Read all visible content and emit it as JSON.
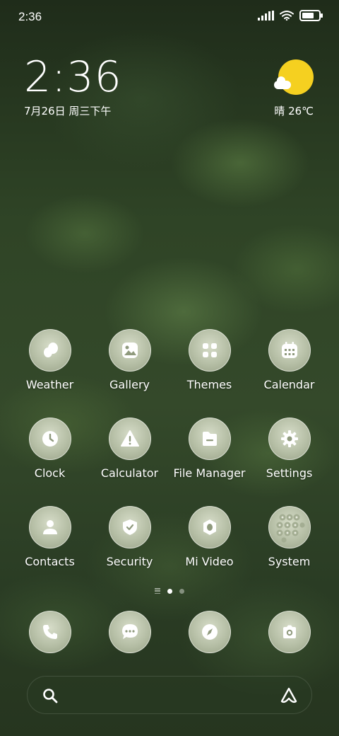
{
  "status_bar": {
    "time": "2:36",
    "battery_percent": 90
  },
  "clock_widget": {
    "time": "2:36",
    "date": "7月26日 周三下午"
  },
  "weather_widget": {
    "text": "晴 26℃",
    "sun_color": "#f5d020"
  },
  "apps": [
    {
      "label": "Weather",
      "icon": "weather-icon"
    },
    {
      "label": "Gallery",
      "icon": "gallery-icon"
    },
    {
      "label": "Themes",
      "icon": "themes-icon"
    },
    {
      "label": "Calendar",
      "icon": "calendar-icon"
    },
    {
      "label": "Clock",
      "icon": "clock-icon"
    },
    {
      "label": "Calculator",
      "icon": "calculator-icon"
    },
    {
      "label": "File Manager",
      "icon": "file-manager-icon"
    },
    {
      "label": "Settings",
      "icon": "gear-icon"
    },
    {
      "label": "Contacts",
      "icon": "contacts-icon"
    },
    {
      "label": "Security",
      "icon": "shield-icon"
    },
    {
      "label": "Mi Video",
      "icon": "video-icon"
    },
    {
      "label": "System",
      "icon": "folder-icon"
    }
  ],
  "page_indicator": {
    "pages": 2,
    "active": 0
  },
  "dock": [
    {
      "icon": "phone-icon"
    },
    {
      "icon": "messages-icon"
    },
    {
      "icon": "compass-icon"
    },
    {
      "icon": "camera-icon"
    }
  ],
  "search_bar": {
    "left_icon": "search-icon",
    "right_icon": "assistant-icon"
  },
  "colors": {
    "icon_glyph": "#6f7a5e",
    "icon_bg": "#c2cab2"
  }
}
